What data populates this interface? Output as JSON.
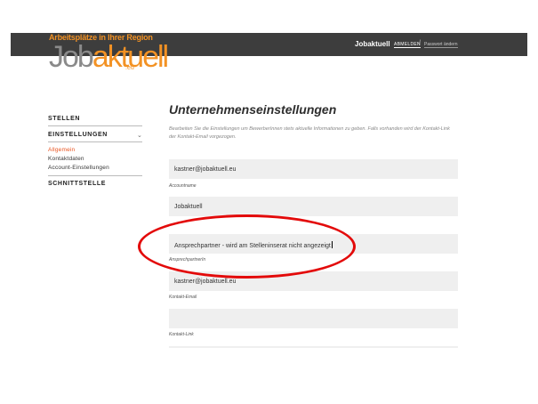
{
  "brand": {
    "tagline": "Arbeitsplätze in Ihrer Region",
    "word_job": "Job",
    "word_aktuell": "aktuell",
    "tld": ".eu"
  },
  "header": {
    "title": "Jobaktuell",
    "logout": "ABMELDEN",
    "separator": "/",
    "password": "Passwort ändern"
  },
  "sidebar": {
    "stellen": "STELLEN",
    "einstellungen": "EINSTELLUNGEN",
    "sub_items": [
      "Allgemein",
      "Kontaktdaten",
      "Account-Einstellungen"
    ],
    "schnittstelle": "SCHNITTSTELLE"
  },
  "main": {
    "title": "Unternehmenseinstellungen",
    "description": "Bearbeiten Sie die Einstellungen um BewerberInnen stets aktuelle Informationen zu geben. Falls vorhanden wird der Kontakt-Link der Kontakt-Email vorgezogen.",
    "fields": [
      {
        "value": "kastner@jobaktuell.eu",
        "label": "Accountname"
      },
      {
        "value": "Jobaktuell",
        "label": ""
      },
      {
        "value": "Ansprechpartner - wird am Stelleninserat nicht angezeigt",
        "label": "AnsprechpartnerIn"
      },
      {
        "value": "kastner@jobaktuell.eu",
        "label": "Kontakt-Email"
      },
      {
        "value": "",
        "label": "Kontakt-Link"
      }
    ]
  },
  "colors": {
    "accent": "#f39224",
    "topbar": "#3d3d3d",
    "annotation": "#e30a0a",
    "active_link": "#e8531f"
  }
}
